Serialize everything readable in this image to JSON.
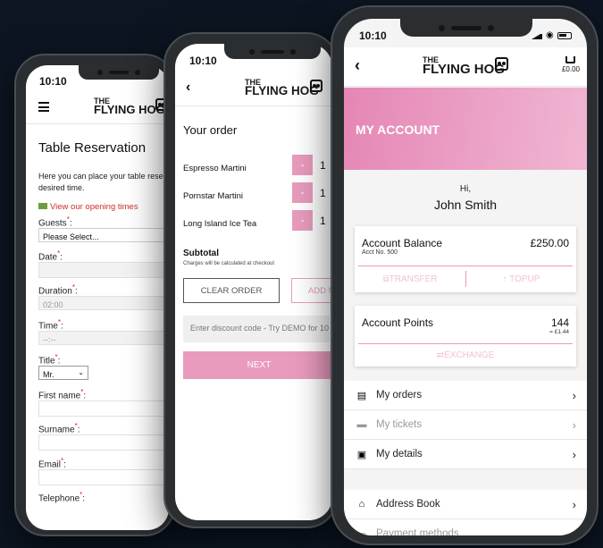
{
  "colors": {
    "accent": "#e89bbd",
    "background": "#0c1622",
    "link_red": "#c9302c"
  },
  "phone1": {
    "time": "10:10",
    "brand_the": "THE",
    "brand_name": "FLYING HOG",
    "title": "Table Reservation",
    "intro_line1": "Here you can place your table reser",
    "intro_line2": "desired time.",
    "opening_link": "View our opening times",
    "guests_label": "Guests",
    "guests_value": "Please Select...",
    "date_label": "Date",
    "duration_label": "Duration",
    "duration_value": "02:00",
    "time_label": "Time",
    "time_value": "--:--",
    "title_label": "Title",
    "title_value": "Mr.",
    "firstname_label": "First name",
    "surname_label": "Surname",
    "email_label": "Email",
    "telephone_label": "Telephone",
    "required_mark": "*",
    "colon": ":"
  },
  "phone2": {
    "time": "10:10",
    "brand_the": "THE",
    "brand_name": "FLYING HOG",
    "heading": "Your order",
    "items": [
      {
        "name": "Espresso Martini",
        "qty": "1"
      },
      {
        "name": "Pornstar Martini",
        "qty": "1"
      },
      {
        "name": "Long Island Ice Tea",
        "qty": "1"
      }
    ],
    "minus": "-",
    "subtotal_label": "Subtotal",
    "subtotal_note": "Charges will be calculated at checkout",
    "clear_order": "CLEAR ORDER",
    "add_more": "ADD M",
    "discount_placeholder": "Enter discount code - Try DEMO for 10",
    "next": "NEXT"
  },
  "phone3": {
    "time": "10:10",
    "brand_the": "THE",
    "brand_name": "FLYING HOG",
    "basket_total": "£0.00",
    "banner_title": "MY ACCOUNT",
    "greeting": "Hi,",
    "user_name": "John Smith",
    "balance_label": "Account Balance",
    "balance_value": "£250.00",
    "acct_no": "Acct No. 500",
    "transfer": "TRANSFER",
    "topup": "TOPUP",
    "points_label": "Account Points",
    "points_value": "144",
    "points_equiv": "= £1.44",
    "exchange": "EXCHANGE",
    "menu": [
      {
        "label": "My orders",
        "icon": "receipt-icon",
        "dim": false
      },
      {
        "label": "My tickets",
        "icon": "ticket-icon",
        "dim": true
      },
      {
        "label": "My details",
        "icon": "id-card-icon",
        "dim": false
      },
      {
        "label": "Address Book",
        "icon": "home-icon",
        "dim": false
      },
      {
        "label": "Payment methods",
        "icon": "card-icon",
        "dim": true
      }
    ]
  }
}
